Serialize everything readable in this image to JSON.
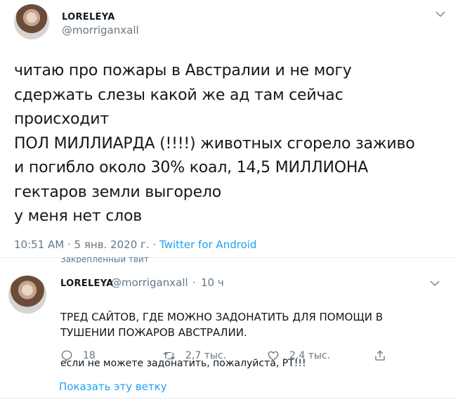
{
  "main_tweet": {
    "display_name": "LORELEYA",
    "handle": "@morriganxall",
    "text": "читаю про пожары в Австралии и не могу\nсдержать слезы какой же ад там сейчас\nпроисходит\nПОЛ МИЛЛИАРДА (!!!!) животных сгорело заживо\nи погибло около 30% коал, 14,5 МИЛЛИОНА\nгектаров земли выгорело\nу меня нет слов",
    "time": "10:51 AM",
    "separator": "·",
    "date": "5 янв. 2020 г.",
    "source": "Twitter for Android"
  },
  "pinned_tweet": {
    "label": "Закрепленный твит",
    "display_name": "LORELEYA",
    "handle": "@morriganxall",
    "dot": "·",
    "time": "10 ч",
    "text_line1": "ТРЕД САЙТОВ, ГДЕ МОЖНО ЗАДОНАТИТЬ ДЛЯ ПОМОЩИ В\nТУШЕНИИ ПОЖАРОВ АВСТРАЛИИ.",
    "text_line2": "если не можете задонатить, пожалуйста, РТ!!!",
    "replies": "18",
    "retweets": "2,7 тыс.",
    "likes": "2,4 тыс.",
    "show_thread": "Показать эту ветку"
  },
  "colors": {
    "accent": "#1da1f2",
    "muted": "#657786",
    "text": "#14171a",
    "divider": "#e6ecf0"
  },
  "icons": [
    "chevron-down-icon",
    "reply-icon",
    "retweet-icon",
    "like-icon",
    "share-icon",
    "pin-icon"
  ]
}
